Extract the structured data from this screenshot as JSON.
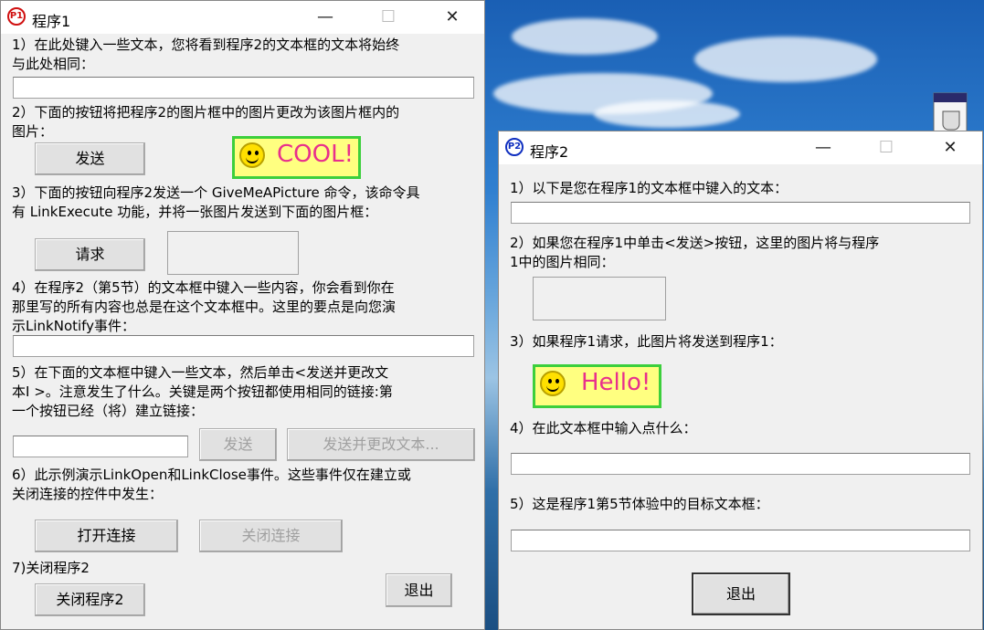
{
  "window1": {
    "title": "程序1",
    "icon": "P1",
    "label1": "1）在此处键入一些文本，您将看到程序2的文本框的文本将始终",
    "label1b": "与此处相同：",
    "text1_value": "",
    "label2": "2）下面的按钮将把程序2的图片框中的图片更改为该图片框内的",
    "label2b": "图片：",
    "send_button": "发送",
    "cool_image_text": "COOL!",
    "label3": "3）下面的按钮向程序2发送一个 GiveMeAPicture 命令，该命令具",
    "label3b": "有 LinkExecute 功能，并将一张图片发送到下面的图片框：",
    "request_button": "请求",
    "label4": "4）在程序2（第5节）的文本框中键入一些内容，你会看到你在",
    "label4b": "那里写的所有内容也总是在这个文本框中。这里的要点是向您演",
    "label4c": "示LinkNotify事件：",
    "text4_value": "",
    "label5": "5）在下面的文本框中键入一些文本，然后单击<发送并更改文",
    "label5b": "本I  >。注意发生了什么。关键是两个按钮都使用相同的链接:第",
    "label5c": "一个按钮已经（将）建立链接：",
    "text5_value": "",
    "send5_button": "发送",
    "send_change_button": "发送并更改文本...",
    "label6": "6）此示例演示LinkOpen和LinkClose事件。这些事件仅在建立或",
    "label6b": "关闭连接的控件中发生：",
    "open_link_button": "打开连接",
    "close_link_button": "关闭连接",
    "label7": "7)关闭程序2",
    "close_prog2_button": "关闭程序2",
    "exit_button": "退出"
  },
  "window2": {
    "title": "程序2",
    "icon": "P2",
    "label1": "1）以下是您在程序1的文本框中键入的文本：",
    "text1_value": "",
    "label2": "2）如果您在程序1中单击<发送>按钮，这里的图片将与程序",
    "label2b": "1中的图片相同：",
    "label3": "3）如果程序1请求，此图片将发送到程序1：",
    "hello_image_text": "Hello!",
    "label4": "4）在此文本框中输入点什么：",
    "text4_value": "",
    "label5": "5）这是程序1第5节体验中的目标文本框：",
    "text5_value": "",
    "exit_button": "退出"
  },
  "titlebar_controls": {
    "minimize": "—",
    "maximize": "☐",
    "close": "✕"
  },
  "colors": {
    "window_bg": "#f0f0f0",
    "sticker_bg": "#ffff80",
    "sticker_border": "#3ccf3c",
    "sticker_text": "#e8308c",
    "icon_p1": "#d01010",
    "icon_p2": "#1030c0"
  }
}
